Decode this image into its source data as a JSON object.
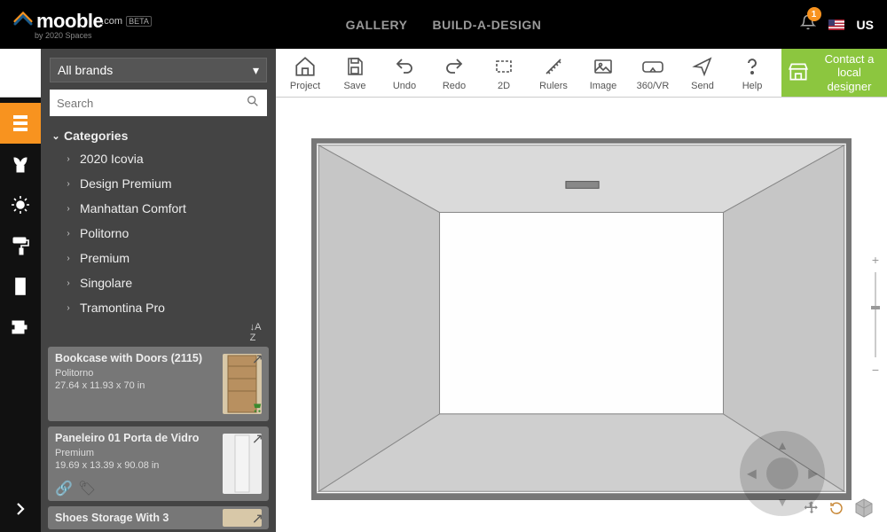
{
  "header": {
    "logo_name": "mooble",
    "logo_tld": ".com",
    "logo_beta": "BETA",
    "byline": "by 2020 Spaces",
    "nav": {
      "gallery": "GALLERY",
      "build": "BUILD-A-DESIGN"
    },
    "badge": "1",
    "country": "US"
  },
  "toolbar": {
    "project": "Project",
    "save": "Save",
    "undo": "Undo",
    "redo": "Redo",
    "view2d": "2D",
    "rulers": "Rulers",
    "image": "Image",
    "vr": "360/VR",
    "send": "Send",
    "help": "Help",
    "contact": "Contact a local designer"
  },
  "sidebar": {
    "brand_select": "All brands",
    "search_placeholder": "Search",
    "categories_label": "Categories",
    "cats": [
      {
        "label": "2020 Icovia"
      },
      {
        "label": "Design Premium"
      },
      {
        "label": "Manhattan Comfort"
      },
      {
        "label": "Politorno"
      },
      {
        "label": "Premium"
      },
      {
        "label": "Singolare"
      },
      {
        "label": "Tramontina Pro"
      }
    ]
  },
  "products": [
    {
      "title": "Bookcase with Doors (2115)",
      "brand": "Politorno",
      "dims": "27.64 x 11.93 x 70 in"
    },
    {
      "title": "Paneleiro 01 Porta de Vidro",
      "brand": "Premium",
      "dims": "19.69 x 13.39 x 90.08 in"
    },
    {
      "title": "Shoes Storage With 3",
      "brand": "",
      "dims": ""
    }
  ]
}
